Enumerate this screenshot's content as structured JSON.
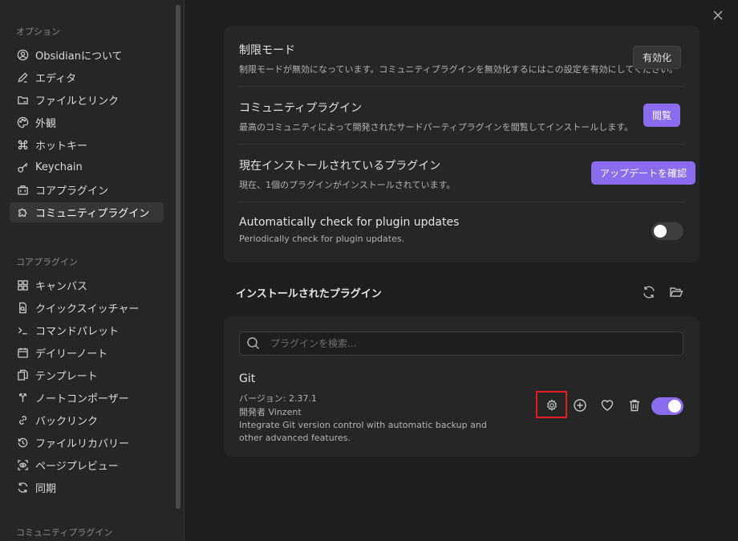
{
  "sidebar": {
    "group_options": "オプション",
    "options": [
      {
        "label": "Obsidianについて",
        "icon": "circle-user-icon"
      },
      {
        "label": "エディタ",
        "icon": "pencil-icon"
      },
      {
        "label": "ファイルとリンク",
        "icon": "folder-link-icon"
      },
      {
        "label": "外観",
        "icon": "palette-icon"
      },
      {
        "label": "ホットキー",
        "icon": "command-icon"
      },
      {
        "label": "Keychain",
        "icon": "key-icon"
      },
      {
        "label": "コアプラグイン",
        "icon": "briefcase-icon"
      },
      {
        "label": "コミュニティプラグイン",
        "icon": "puzzle-icon",
        "active": true
      }
    ],
    "group_core": "コアプラグイン",
    "core": [
      {
        "label": "キャンバス",
        "icon": "layout-grid-icon"
      },
      {
        "label": "クイックスイッチャー",
        "icon": "file-search-icon"
      },
      {
        "label": "コマンドパレット",
        "icon": "terminal-icon"
      },
      {
        "label": "デイリーノート",
        "icon": "calendar-icon"
      },
      {
        "label": "テンプレート",
        "icon": "files-icon"
      },
      {
        "label": "ノートコンポーザー",
        "icon": "merge-icon"
      },
      {
        "label": "バックリンク",
        "icon": "links-icon"
      },
      {
        "label": "ファイルリカバリー",
        "icon": "history-icon"
      },
      {
        "label": "ページプレビュー",
        "icon": "scan-eye-icon"
      },
      {
        "label": "同期",
        "icon": "refresh-icon"
      }
    ],
    "group_community": "コミュニティプラグイン"
  },
  "settings": {
    "restricted": {
      "title": "制限モード",
      "desc": "制限モードが無効になっています。コミュニティプラグインを無効化するにはこの設定を有効にしてください。",
      "button": "有効化"
    },
    "community": {
      "title": "コミュニティプラグイン",
      "desc": "最高のコミュニティによって開発されたサードパーティプラグインを閲覧してインストールします。",
      "button": "閲覧"
    },
    "installed": {
      "title": "現在インストールされているプラグイン",
      "desc": "現在、1個のプラグインがインストールされています。",
      "button": "アップデートを確認"
    },
    "autocheck": {
      "title": "Automatically check for plugin updates",
      "desc": "Periodically check for plugin updates.",
      "enabled": false
    }
  },
  "installed_section": {
    "title": "インストールされたプラグイン",
    "search_placeholder": "プラグインを検索..."
  },
  "plugin": {
    "name": "Git",
    "version": "バージョン: 2.37.1",
    "author": "開発者 Vinzent",
    "desc": "Integrate Git version control with automatic backup and other advanced features.",
    "enabled": true
  },
  "colors": {
    "accent": "#8b6cef",
    "highlight": "#e21b1b"
  }
}
